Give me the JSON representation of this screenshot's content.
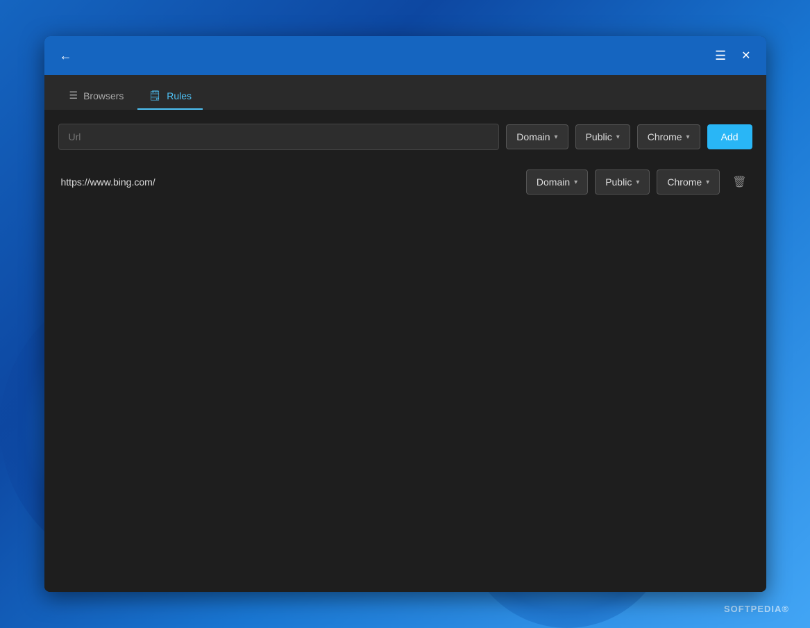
{
  "titlebar": {
    "back_label": "←",
    "hamburger_label": "☰",
    "close_label": "✕"
  },
  "tabs": [
    {
      "id": "browsers",
      "icon": "☰",
      "label": "Browsers",
      "active": false
    },
    {
      "id": "rules",
      "icon": "📋",
      "label": "Rules",
      "active": true
    }
  ],
  "add_form": {
    "url_placeholder": "Url",
    "domain_label": "Domain",
    "public_label": "Public",
    "chrome_label": "Chrome",
    "add_button_label": "Add"
  },
  "rules": [
    {
      "url": "https://www.bing.com/",
      "domain": "Domain",
      "visibility": "Public",
      "browser": "Chrome"
    }
  ],
  "watermark": {
    "text": "SOFTPEDIA",
    "symbol": "®"
  }
}
